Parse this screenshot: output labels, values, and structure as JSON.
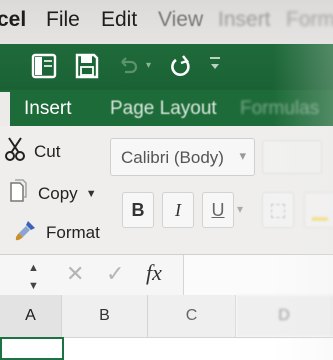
{
  "menu": {
    "app": "cel",
    "file": "File",
    "edit": "Edit",
    "view": "View",
    "insert": "Insert",
    "format": "Format"
  },
  "quick_access": {
    "icons": [
      "sidebar-toggle-icon",
      "save-icon",
      "undo-icon",
      "redo-icon",
      "customize-icon"
    ]
  },
  "tabs": {
    "insert": "Insert",
    "page_layout": "Page Layout",
    "formulas": "Formulas"
  },
  "clipboard": {
    "cut": "Cut",
    "copy": "Copy",
    "format": "Format"
  },
  "font": {
    "name": "Calibri (Body)",
    "bold": "B",
    "italic": "I",
    "underline": "U"
  },
  "formula_bar": {
    "fx": "fx",
    "value": ""
  },
  "columns": [
    "A",
    "B",
    "C",
    "D"
  ],
  "colors": {
    "excel_green": "#1d6b38",
    "menu_bg": "#dcdad8",
    "ribbon_bg": "#efeeed",
    "selection_border": "#1e7145"
  }
}
